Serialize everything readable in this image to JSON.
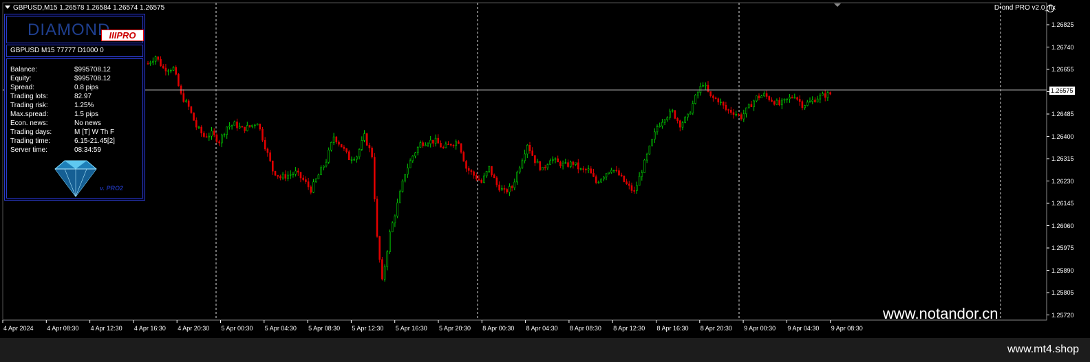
{
  "chart_header": {
    "symbol_line": "GBPUSD,M15  1.26578 1.26584 1.26574 1.26575",
    "ea_title": "D•ond PRO v2.0_fix"
  },
  "current_price_label": "1.26575",
  "panel": {
    "logo_text": "DIAMOND",
    "logo_badge": "IIIPRO",
    "account_line": "GBPUSD M15 77777  D1000 0",
    "rows": [
      {
        "key": "Balance:",
        "value": "$995708.12"
      },
      {
        "key": "Equity:",
        "value": "$995708.12"
      },
      {
        "key": "Spread:",
        "value": "0.8 pips"
      },
      {
        "key": "Trading lots:",
        "value": "82.97"
      },
      {
        "key": "Trading risk:",
        "value": "1.25%"
      },
      {
        "key": "Max.spread:",
        "value": "1.5 pips"
      },
      {
        "key": "Econ. news:",
        "value": "No news"
      },
      {
        "key": "Trading days:",
        "value": "M [T] W Th F"
      },
      {
        "key": "Trading time:",
        "value": "6.15-21.45[2]"
      },
      {
        "key": "Server time:",
        "value": "08:34:59"
      }
    ],
    "version": "v. PRO2"
  },
  "watermark": "www.notandor.cn",
  "bottom_site": "www.mt4.shop",
  "colors": {
    "bull": "#00d000",
    "bear": "#e00000",
    "background": "#000000",
    "panel_border": "#2a3ac8",
    "grid": "#ffffff"
  },
  "chart_data": {
    "type": "candlestick",
    "y_ticks": [
      "1.26825",
      "1.26740",
      "1.26655",
      "1.26575",
      "1.26485",
      "1.26400",
      "1.26315",
      "1.26230",
      "1.26145",
      "1.26060",
      "1.25975",
      "1.25890",
      "1.25805",
      "1.25720"
    ],
    "x_ticks": [
      "4 Apr 2024",
      "4 Apr 08:30",
      "4 Apr 12:30",
      "4 Apr 16:30",
      "4 Apr 20:30",
      "5 Apr 00:30",
      "5 Apr 04:30",
      "5 Apr 08:30",
      "5 Apr 12:30",
      "5 Apr 16:30",
      "5 Apr 20:30",
      "8 Apr 00:30",
      "8 Apr 04:30",
      "8 Apr 08:30",
      "8 Apr 12:30",
      "8 Apr 16:30",
      "8 Apr 20:30",
      "9 Apr 00:30",
      "9 Apr 04:30",
      "9 Apr 08:30"
    ],
    "ylim": [
      1.257,
      1.2686
    ],
    "current_price": 1.26575,
    "close_path": [
      [
        0,
        1.267
      ],
      [
        3,
        1.2673
      ],
      [
        6,
        1.2668
      ],
      [
        10,
        1.2668
      ],
      [
        13,
        1.2657
      ],
      [
        16,
        1.2652
      ],
      [
        19,
        1.2644
      ],
      [
        22,
        1.264
      ],
      [
        25,
        1.2641
      ],
      [
        28,
        1.2638
      ],
      [
        31,
        1.2644
      ],
      [
        34,
        1.2645
      ],
      [
        37,
        1.2643
      ],
      [
        40,
        1.2644
      ],
      [
        43,
        1.2646
      ],
      [
        46,
        1.2636
      ],
      [
        49,
        1.2626
      ],
      [
        52,
        1.2623
      ],
      [
        55,
        1.2624
      ],
      [
        58,
        1.2625
      ],
      [
        61,
        1.2622
      ],
      [
        64,
        1.2618
      ],
      [
        67,
        1.2624
      ],
      [
        70,
        1.263
      ],
      [
        73,
        1.264
      ],
      [
        76,
        1.2636
      ],
      [
        79,
        1.2631
      ],
      [
        82,
        1.2632
      ],
      [
        85,
        1.264
      ],
      [
        88,
        1.2632
      ],
      [
        90,
        1.2598
      ],
      [
        92,
        1.258
      ],
      [
        95,
        1.26
      ],
      [
        98,
        1.2612
      ],
      [
        101,
        1.2625
      ],
      [
        104,
        1.2632
      ],
      [
        107,
        1.2637
      ],
      [
        110,
        1.2638
      ],
      [
        113,
        1.2638
      ],
      [
        116,
        1.2635
      ],
      [
        119,
        1.2637
      ],
      [
        122,
        1.2638
      ],
      [
        125,
        1.2627
      ],
      [
        128,
        1.2624
      ],
      [
        131,
        1.2621
      ],
      [
        134,
        1.2627
      ],
      [
        137,
        1.262
      ],
      [
        140,
        1.2617
      ],
      [
        143,
        1.2619
      ],
      [
        146,
        1.2628
      ],
      [
        149,
        1.2637
      ],
      [
        152,
        1.263
      ],
      [
        155,
        1.2626
      ],
      [
        158,
        1.2631
      ],
      [
        161,
        1.2629
      ],
      [
        164,
        1.2628
      ],
      [
        167,
        1.2629
      ],
      [
        170,
        1.2626
      ],
      [
        173,
        1.2626
      ],
      [
        176,
        1.2621
      ],
      [
        179,
        1.2624
      ],
      [
        182,
        1.2627
      ],
      [
        185,
        1.2624
      ],
      [
        188,
        1.262
      ],
      [
        191,
        1.2617
      ],
      [
        194,
        1.2626
      ],
      [
        197,
        1.2635
      ],
      [
        200,
        1.2644
      ],
      [
        203,
        1.2648
      ],
      [
        206,
        1.265
      ],
      [
        209,
        1.2645
      ],
      [
        212,
        1.2648
      ],
      [
        215,
        1.2656
      ],
      [
        218,
        1.2662
      ],
      [
        221,
        1.2656
      ],
      [
        224,
        1.2655
      ],
      [
        227,
        1.2651
      ],
      [
        230,
        1.265
      ],
      [
        233,
        1.2648
      ],
      [
        236,
        1.2652
      ],
      [
        239,
        1.2656
      ],
      [
        242,
        1.2657
      ],
      [
        245,
        1.2655
      ],
      [
        248,
        1.2653
      ],
      [
        251,
        1.2655
      ],
      [
        254,
        1.2657
      ],
      [
        257,
        1.2653
      ],
      [
        260,
        1.2654
      ],
      [
        263,
        1.2656
      ],
      [
        266,
        1.2657
      ],
      [
        268,
        1.26575
      ]
    ]
  }
}
